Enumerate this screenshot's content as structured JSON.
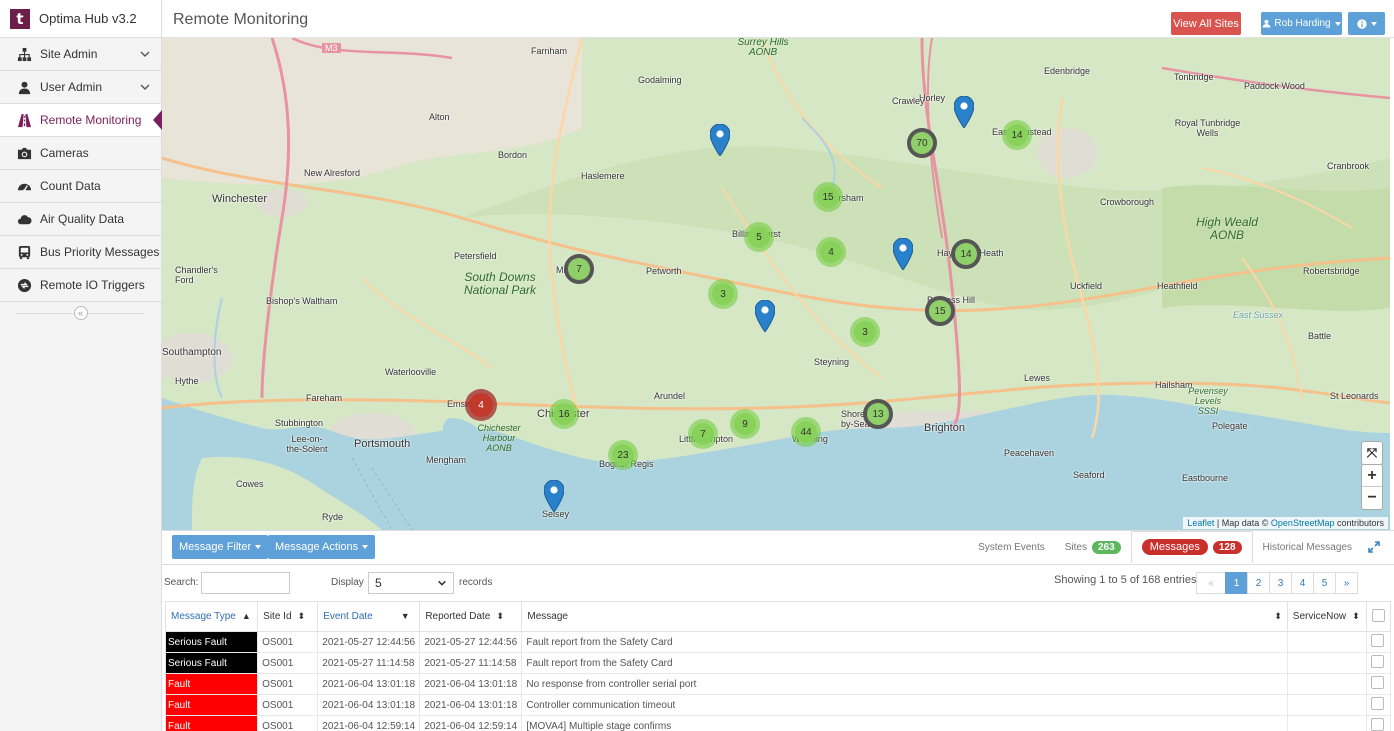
{
  "app": {
    "name": "Optima Hub v3.2",
    "logo_letter": "t"
  },
  "sidebar": {
    "items": [
      {
        "label": "Site Admin",
        "icon": "sitemap-icon",
        "expandable": true
      },
      {
        "label": "User Admin",
        "icon": "user-icon",
        "expandable": true
      },
      {
        "label": "Remote Monitoring",
        "icon": "road-icon",
        "active": true
      },
      {
        "label": "Cameras",
        "icon": "camera-icon"
      },
      {
        "label": "Count Data",
        "icon": "dashboard-icon"
      },
      {
        "label": "Air Quality Data",
        "icon": "cloud-icon"
      },
      {
        "label": "Bus Priority Messages",
        "icon": "bus-icon"
      },
      {
        "label": "Remote IO Triggers",
        "icon": "arrows-icon"
      }
    ],
    "collapse_glyph": "«"
  },
  "header": {
    "title": "Remote Monitoring",
    "view_all_sites": "View All Sites",
    "user": "Rob Harding"
  },
  "map": {
    "places": [
      "Winchester",
      "New Alresford",
      "Alton",
      "Farnham",
      "Godalming",
      "Bordon",
      "Haslemere",
      "Horley",
      "Edenbridge",
      "Tonbridge",
      "Paddock Wood",
      "Royal Tunbridge Wells",
      "Cranbrook",
      "Crowborough",
      "Chandler's Ford",
      "Bishop's Waltham",
      "Petersfield",
      "Petworth",
      "Uckfield",
      "Heathfield",
      "Robertsbridge",
      "Battle",
      "Southampton",
      "Hythe",
      "Waterlooville",
      "Steyning",
      "Lewes",
      "Hailsham",
      "St Leonards",
      "Fareham",
      "Emsworth",
      "Chichester",
      "Arundel",
      "Brighton",
      "Stubbington",
      "Lee-on-the-Solent",
      "Portsmouth",
      "Littlehampton",
      "Worthing",
      "Peacehaven",
      "Seaford",
      "Eastbourne",
      "Polegate",
      "Mengham",
      "Cowes",
      "Ryde",
      "Selsey",
      "Bognor Regis",
      "Shoreham-by-Sea",
      "Burgess Hill",
      "Haywards Heath",
      "East Grinstead",
      "Billingshurst",
      "Midhurst",
      "Crawley",
      "Horsham",
      "M3",
      "East Sussex",
      "Pevensey Levels SSSI"
    ],
    "parks": [
      "South Downs National Park",
      "High Weald AONB",
      "Chichester Harbour AONB",
      "Surrey Hills AONB"
    ],
    "clusters": [
      {
        "count": "70",
        "style": "grey"
      },
      {
        "count": "14",
        "style": "green"
      },
      {
        "count": "15",
        "style": "green"
      },
      {
        "count": "5",
        "style": "green"
      },
      {
        "count": "4",
        "style": "green"
      },
      {
        "count": "14",
        "style": "grey"
      },
      {
        "count": "7",
        "style": "grey"
      },
      {
        "count": "3",
        "style": "green"
      },
      {
        "count": "15",
        "style": "grey"
      },
      {
        "count": "3",
        "style": "green"
      },
      {
        "count": "4",
        "style": "red"
      },
      {
        "count": "16",
        "style": "green"
      },
      {
        "count": "7",
        "style": "green"
      },
      {
        "count": "9",
        "style": "green"
      },
      {
        "count": "44",
        "style": "green"
      },
      {
        "count": "13",
        "style": "grey"
      },
      {
        "count": "23",
        "style": "green"
      }
    ],
    "pin_count": 5,
    "attribution": {
      "leaflet": "Leaflet",
      "separator": " | Map data © ",
      "osm": "OpenStreetMap",
      "contributors": " contributors"
    },
    "zoom_in": "+",
    "zoom_out": "−",
    "fullscreen": "⤧"
  },
  "panel": {
    "message_filter": "Message Filter",
    "message_actions": "Message Actions",
    "tabs": {
      "system_events": "System Events",
      "sites": "Sites",
      "sites_count": "263",
      "messages": "Messages",
      "messages_count": "128",
      "historical": "Historical Messages"
    },
    "search_label": "Search:",
    "display_label": "Display",
    "display_value": "5",
    "records_label": "records",
    "showing": "Showing 1 to 5 of 168 entries",
    "pager": [
      "«",
      "1",
      "2",
      "3",
      "4",
      "5",
      "»"
    ],
    "columns": [
      "Message Type",
      "Site Id",
      "Event Date",
      "Reported Date",
      "Message",
      "ServiceNow"
    ],
    "rows": [
      {
        "type": "Serious Fault",
        "kind": "sf",
        "site": "OS001",
        "event": "2021-05-27 12:44:56",
        "reported": "2021-05-27 12:44:56",
        "message": "Fault report from the Safety Card"
      },
      {
        "type": "Serious Fault",
        "kind": "sf",
        "site": "OS001",
        "event": "2021-05-27 11:14:58",
        "reported": "2021-05-27 11:14:58",
        "message": "Fault report from the Safety Card"
      },
      {
        "type": "Fault",
        "kind": "f",
        "site": "OS001",
        "event": "2021-06-04 13:01:18",
        "reported": "2021-06-04 13:01:18",
        "message": "No response from controller serial port"
      },
      {
        "type": "Fault",
        "kind": "f",
        "site": "OS001",
        "event": "2021-06-04 13:01:18",
        "reported": "2021-06-04 13:01:18",
        "message": "Controller communication timeout"
      },
      {
        "type": "Fault",
        "kind": "f",
        "site": "OS001",
        "event": "2021-06-04 12:59:14",
        "reported": "2021-06-04 12:59:14",
        "message": "[MOVA4] Multiple stage confirms"
      }
    ]
  },
  "colors": {
    "brand": "#6b1f4a",
    "active_nav": "#7b1e5d",
    "danger": "#d9534f",
    "primary": "#5ea0d8",
    "serious_fault": "#000000",
    "fault": "#ff0000"
  }
}
